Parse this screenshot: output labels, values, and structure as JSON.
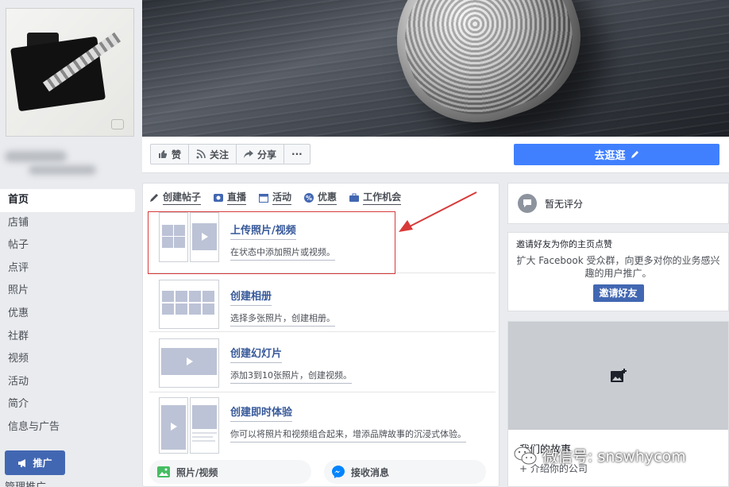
{
  "sidebar": {
    "items": [
      {
        "label": "首页",
        "active": true
      },
      {
        "label": "店铺"
      },
      {
        "label": "帖子"
      },
      {
        "label": "点评"
      },
      {
        "label": "照片"
      },
      {
        "label": "优惠"
      },
      {
        "label": "社群"
      },
      {
        "label": "视频"
      },
      {
        "label": "活动"
      },
      {
        "label": "简介"
      },
      {
        "label": "信息与广告"
      }
    ],
    "promote_label": "推广",
    "manage_label": "管理推广"
  },
  "actionbar": {
    "like_label": "赞",
    "follow_label": "关注",
    "share_label": "分享",
    "more_label": "···",
    "shop_label": "去逛逛"
  },
  "composer": {
    "tabs": [
      {
        "label": "创建帖子",
        "icon": "pencil-icon"
      },
      {
        "label": "直播",
        "icon": "live-video-icon"
      },
      {
        "label": "活动",
        "icon": "calendar-icon"
      },
      {
        "label": "优惠",
        "icon": "offer-tag-icon"
      },
      {
        "label": "工作机会",
        "icon": "briefcase-icon"
      }
    ],
    "options": [
      {
        "title": "上传照片/视频",
        "desc": "在状态中添加照片或视频。"
      },
      {
        "title": "创建相册",
        "desc": "选择多张照片，创建相册。"
      },
      {
        "title": "创建幻灯片",
        "desc": "添加3到10张照片，创建视频。"
      },
      {
        "title": "创建即时体验",
        "desc": "你可以将照片和视频组合起来，增添品牌故事的沉浸式体验。"
      }
    ],
    "bottom": {
      "photo_video_label": "照片/视频",
      "messages_label": "接收消息"
    }
  },
  "right": {
    "rating_text": "暂无评分",
    "invite_title": "邀请好友为你的主页点赞",
    "invite_desc": "扩大 Facebook 受众群，向更多对你的业务感兴趣的用户推广。",
    "invite_button": "邀请好友",
    "story_title": "我们的故事",
    "story_add": "+ 介绍你的公司"
  },
  "watermark": "微信号: snswhycom",
  "colors": {
    "brand_blue": "#4267b2",
    "shop_button": "#4080ff",
    "link_blue": "#365899",
    "highlight_red": "#d83a3a"
  }
}
